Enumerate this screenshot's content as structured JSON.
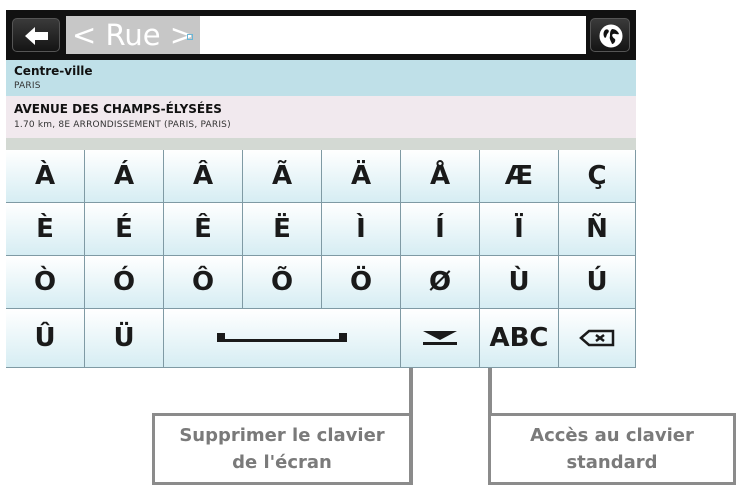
{
  "search": {
    "placeholder": "< Rue >"
  },
  "results": [
    {
      "title": "Centre-ville",
      "subtitle": "PARIS"
    },
    {
      "title": "AVENUE DES CHAMPS-ÉLYSÉES",
      "subtitle": "1.70 km, 8E ARRONDISSEMENT (PARIS, PARIS)"
    }
  ],
  "keyboard": {
    "rows": [
      [
        "À",
        "Á",
        "Â",
        "Ã",
        "Ä",
        "Å",
        "Æ",
        "Ç"
      ],
      [
        "È",
        "É",
        "Ê",
        "Ë",
        "Ì",
        "Í",
        "Ï",
        "Ñ"
      ],
      [
        "Ò",
        "Ó",
        "Ô",
        "Õ",
        "Ö",
        "Ø",
        "Ù",
        "Ú"
      ]
    ],
    "bottom": {
      "u_circ": "Û",
      "u_uml": "Ü",
      "abc": "ABC"
    }
  },
  "callouts": {
    "hide_keyboard": {
      "line1": "Supprimer le clavier",
      "line2": "de l'écran"
    },
    "standard_keyboard": {
      "line1": "Accès au clavier",
      "line2": "standard"
    }
  },
  "colors": {
    "key_top": "#ffffff",
    "key_bottom": "#d6edf3",
    "row_blue": "#bfe0e8",
    "row_pink": "#f1e9ee",
    "callout_border": "#8b8b8b"
  },
  "icons": {
    "back": "arrow-left-icon",
    "globe": "globe-icon",
    "space": "space-bar-icon",
    "hide": "hide-keyboard-icon",
    "backspace": "backspace-icon"
  }
}
